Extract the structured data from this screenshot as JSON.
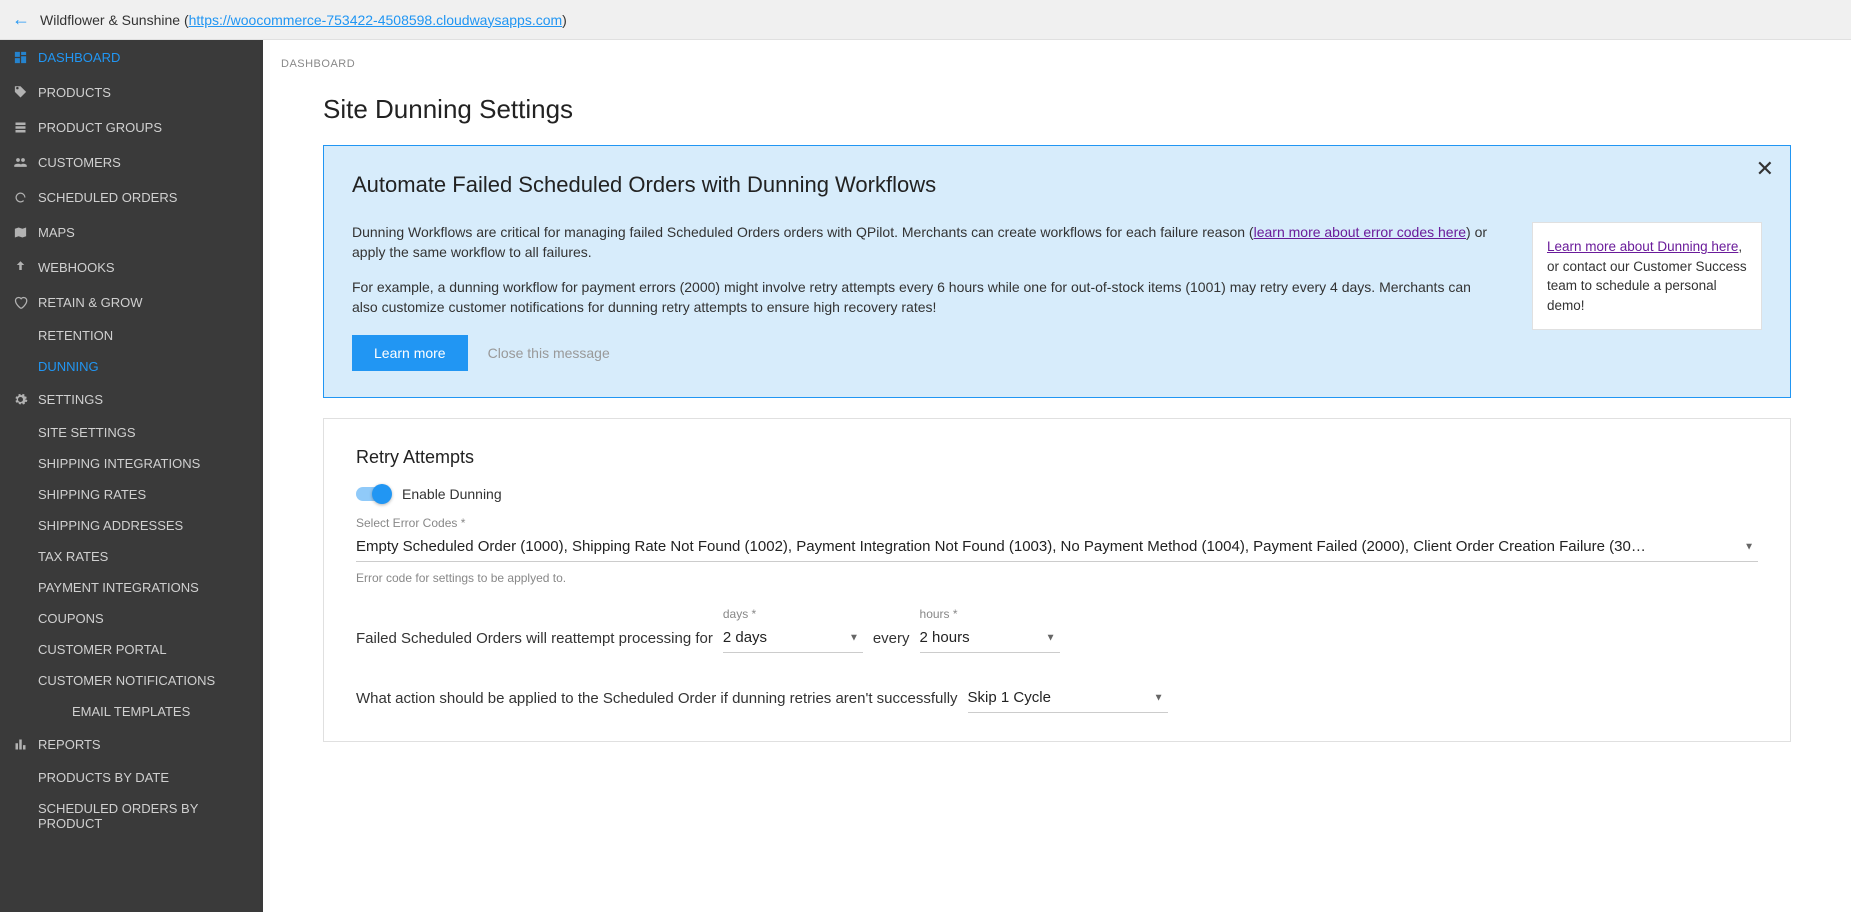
{
  "topbar": {
    "site_name": "Wildflower & Sunshine",
    "site_url": "https://woocommerce-753422-4508598.cloudwaysapps.com"
  },
  "sidebar": {
    "items": {
      "dashboard": "DASHBOARD",
      "products": "PRODUCTS",
      "product_groups": "PRODUCT GROUPS",
      "customers": "CUSTOMERS",
      "scheduled_orders": "SCHEDULED ORDERS",
      "maps": "MAPS",
      "webhooks": "WEBHOOKS",
      "retain_grow": "RETAIN & GROW",
      "retention": "RETENTION",
      "dunning": "DUNNING",
      "settings": "SETTINGS",
      "site_settings": "SITE SETTINGS",
      "shipping_integrations": "SHIPPING INTEGRATIONS",
      "shipping_rates": "SHIPPING RATES",
      "shipping_addresses": "SHIPPING ADDRESSES",
      "tax_rates": "TAX RATES",
      "payment_integrations": "PAYMENT INTEGRATIONS",
      "coupons": "COUPONS",
      "customer_portal": "CUSTOMER PORTAL",
      "customer_notifications": "CUSTOMER NOTIFICATIONS",
      "email_templates": "EMAIL TEMPLATES",
      "reports": "REPORTS",
      "products_by_date": "PRODUCTS BY DATE",
      "scheduled_orders_by_product": "SCHEDULED ORDERS BY PRODUCT"
    }
  },
  "breadcrumb": "DASHBOARD",
  "page_title": "Site Dunning Settings",
  "info": {
    "heading": "Automate Failed Scheduled Orders with Dunning Workflows",
    "para1_a": "Dunning Workflows are critical for managing failed Scheduled Orders orders with QPilot. Merchants can create workflows for each failure reason (",
    "para1_link": "learn more about error codes here",
    "para1_b": ") or apply the same workflow to all failures.",
    "para2": "For example, a dunning workflow for payment errors (2000) might involve retry attempts every 6 hours while one for out-of-stock items (1001) may retry every 4 days. Merchants can also customize customer notifications for dunning retry attempts to ensure high recovery rates!",
    "learn_more_btn": "Learn more",
    "close_btn": "Close this message",
    "aside_link": "Learn more about Dunning here",
    "aside_text": ", or contact our Customer Success team to schedule a personal demo!"
  },
  "retry": {
    "heading": "Retry Attempts",
    "enable_label": "Enable Dunning",
    "error_codes_label": "Select Error Codes *",
    "error_codes_value": "Empty Scheduled Order (1000), Shipping Rate Not Found (1002), Payment Integration Not Found (1003), No Payment Method (1004), Payment Failed (2000), Client Order Creation Failure (30…",
    "error_codes_helper": "Error code for settings to be applyed to.",
    "sentence1_a": "Failed Scheduled Orders will reattempt processing for",
    "days_label": "days *",
    "days_value": "2 days",
    "sentence1_b": "every",
    "hours_label": "hours *",
    "hours_value": "2 hours",
    "sentence2": "What action should be applied to the Scheduled Order if dunning retries aren't successfully",
    "action_value": "Skip 1 Cycle"
  }
}
